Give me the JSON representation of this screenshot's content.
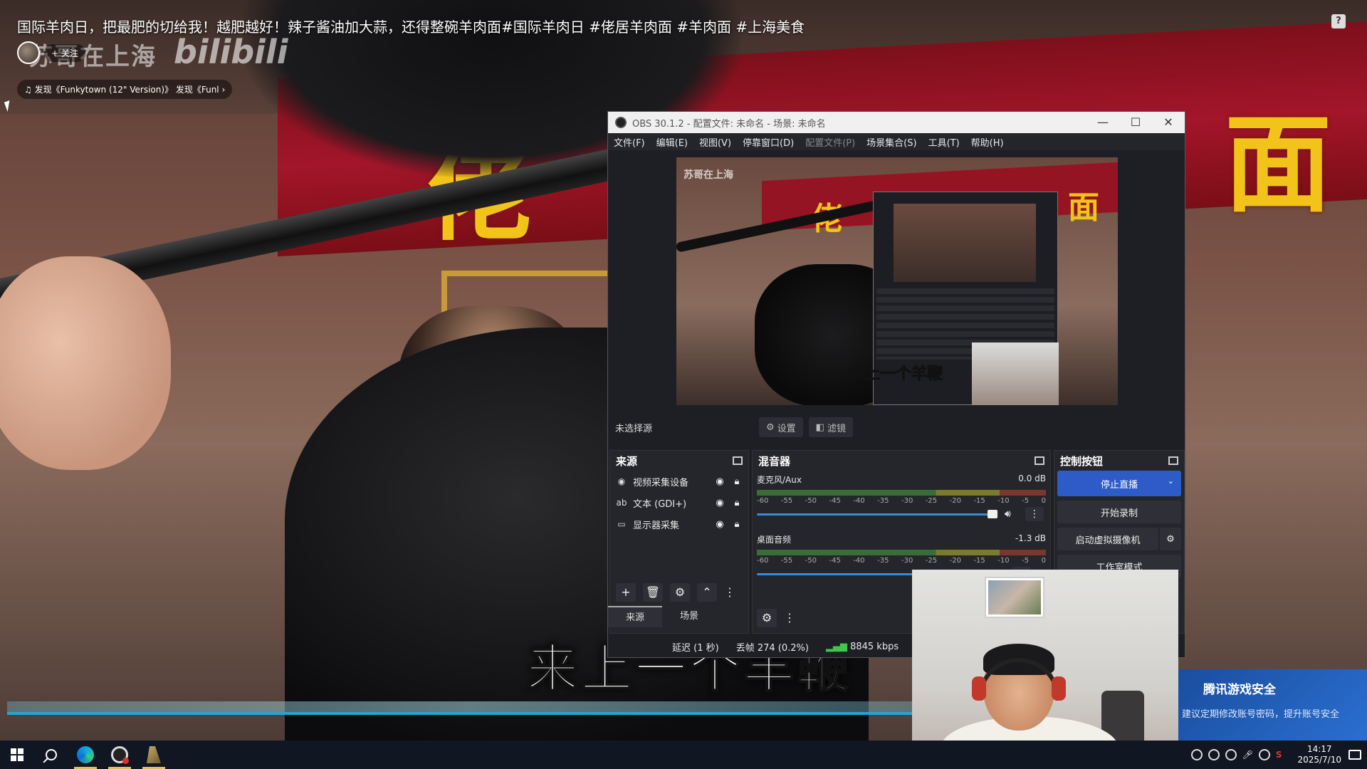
{
  "video": {
    "title": "国际羊肉日，把最肥的切给我！越肥越好！辣子酱油加大蒜，还得整碗羊肉面#国际羊肉日 #佬居羊肉面 #羊肉面 #上海美食",
    "follow_label": "+ 关注",
    "watermark": "苏哥在上海",
    "watermark_logo": "bilibili",
    "music": "发现《Funkytown (12\" Version)》 发现《Funl ›",
    "subtitle": "来上一个羊鞭",
    "help": "?",
    "banner_chars": [
      "佬",
      "面"
    ]
  },
  "tencent": {
    "title": "腾讯游戏安全",
    "sub": "建议定期修改账号密码，提升账号安全"
  },
  "obs": {
    "title": "OBS 30.1.2 - 配置文件: 未命名 - 场景: 未命名",
    "window_buttons": [
      "—",
      "☐",
      "✕"
    ],
    "menu": [
      "文件(F)",
      "编辑(E)",
      "视图(V)",
      "停靠窗口(D)",
      "配置文件(P)",
      "场景集合(S)",
      "工具(T)",
      "帮助(H)"
    ],
    "no_source": "未选择源",
    "settings_btn": "设置",
    "filters_btn": "滤镜",
    "sources": {
      "title": "来源",
      "items": [
        {
          "icon": "camera-icon",
          "label": "视频采集设备"
        },
        {
          "icon": "text-icon",
          "label": "文本 (GDI+)"
        },
        {
          "icon": "monitor-icon",
          "label": "显示器采集"
        }
      ]
    },
    "mixer": {
      "title": "混音器",
      "channels": [
        {
          "name": "麦克风/Aux",
          "db": "0.0 dB",
          "level": 0.85
        },
        {
          "name": "桌面音频",
          "db": "-1.3 dB",
          "level": 0.83
        }
      ],
      "ticks": [
        "-60",
        "-55",
        "-50",
        "-45",
        "-40",
        "-35",
        "-30",
        "-25",
        "-20",
        "-15",
        "-10",
        "-5",
        "0"
      ]
    },
    "controls": {
      "title": "控制按钮",
      "stop_stream": "停止直播",
      "start_record": "开始录制",
      "virtual_cam": "启动虚拟摄像机",
      "studio_mode": "工作室模式"
    },
    "tabs": [
      "来源",
      "场景"
    ],
    "status": {
      "delay": "延迟 (1 秒)",
      "dropped": "丢帧 274 (0.2%)",
      "bitrate": "8845 kbps"
    }
  },
  "taskbar": {
    "time": "14:17",
    "date": "2025/7/10"
  },
  "colors": {
    "accent_blue": "#2d5cc9",
    "banner_red": "#a3152a",
    "gold": "#f2c318"
  }
}
